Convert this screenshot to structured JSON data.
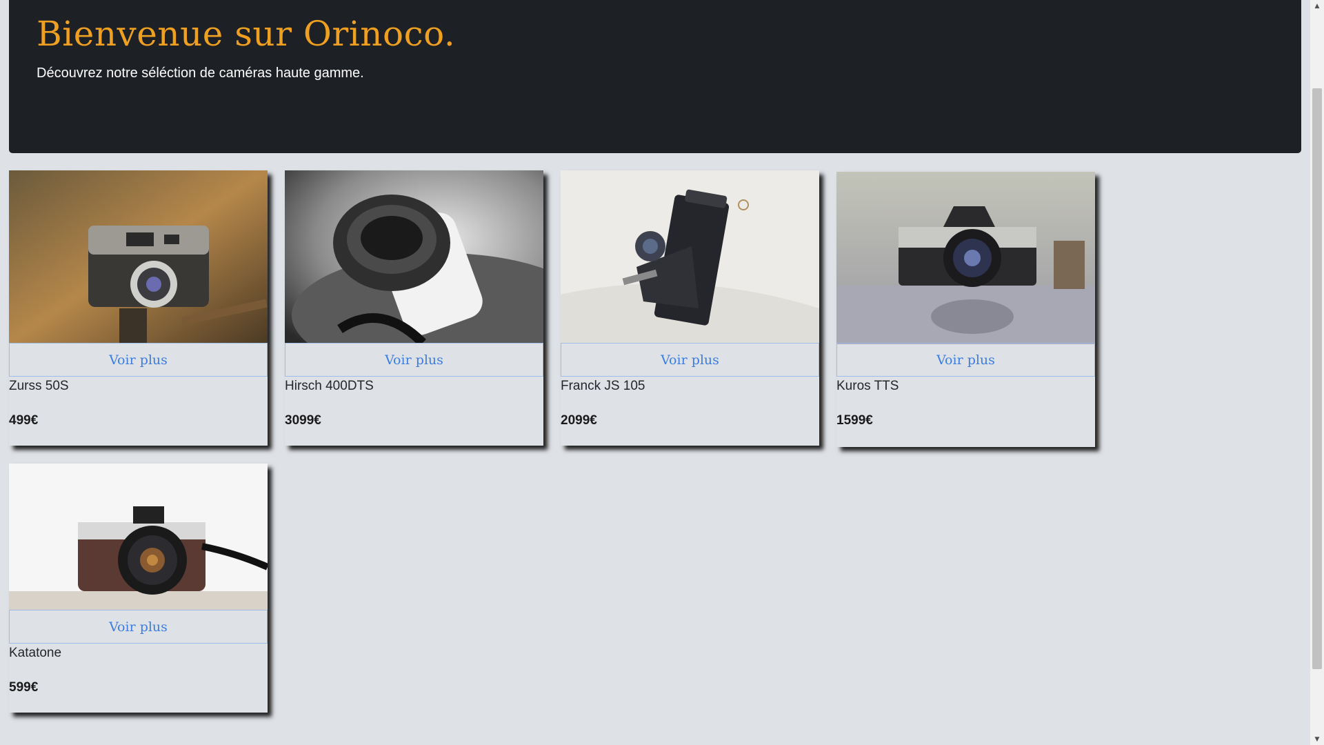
{
  "header": {
    "title": "Bienvenue sur Orinoco.",
    "subtitle": "Découvrez notre séléction de caméras haute gamme."
  },
  "products": [
    {
      "name": "Zurss 50S",
      "price": "499€",
      "button": "Voir plus",
      "image": "camera-photo"
    },
    {
      "name": "Hirsch 400DTS",
      "price": "3099€",
      "button": "Voir plus",
      "image": "camera-photo"
    },
    {
      "name": "Franck JS 105",
      "price": "2099€",
      "button": "Voir plus",
      "image": "camera-photo"
    },
    {
      "name": "Kuros TTS",
      "price": "1599€",
      "button": "Voir plus",
      "image": "camera-photo"
    },
    {
      "name": "Katatone",
      "price": "599€",
      "button": "Voir plus",
      "image": "camera-photo"
    }
  ],
  "colors": {
    "background": "#dee1e6",
    "header_bg": "#1d2025",
    "title": "#f0a020",
    "button_text": "#3b7de0"
  },
  "scrollbar": {
    "up_icon": "arrow-up-icon",
    "down_icon": "arrow-down-icon"
  }
}
